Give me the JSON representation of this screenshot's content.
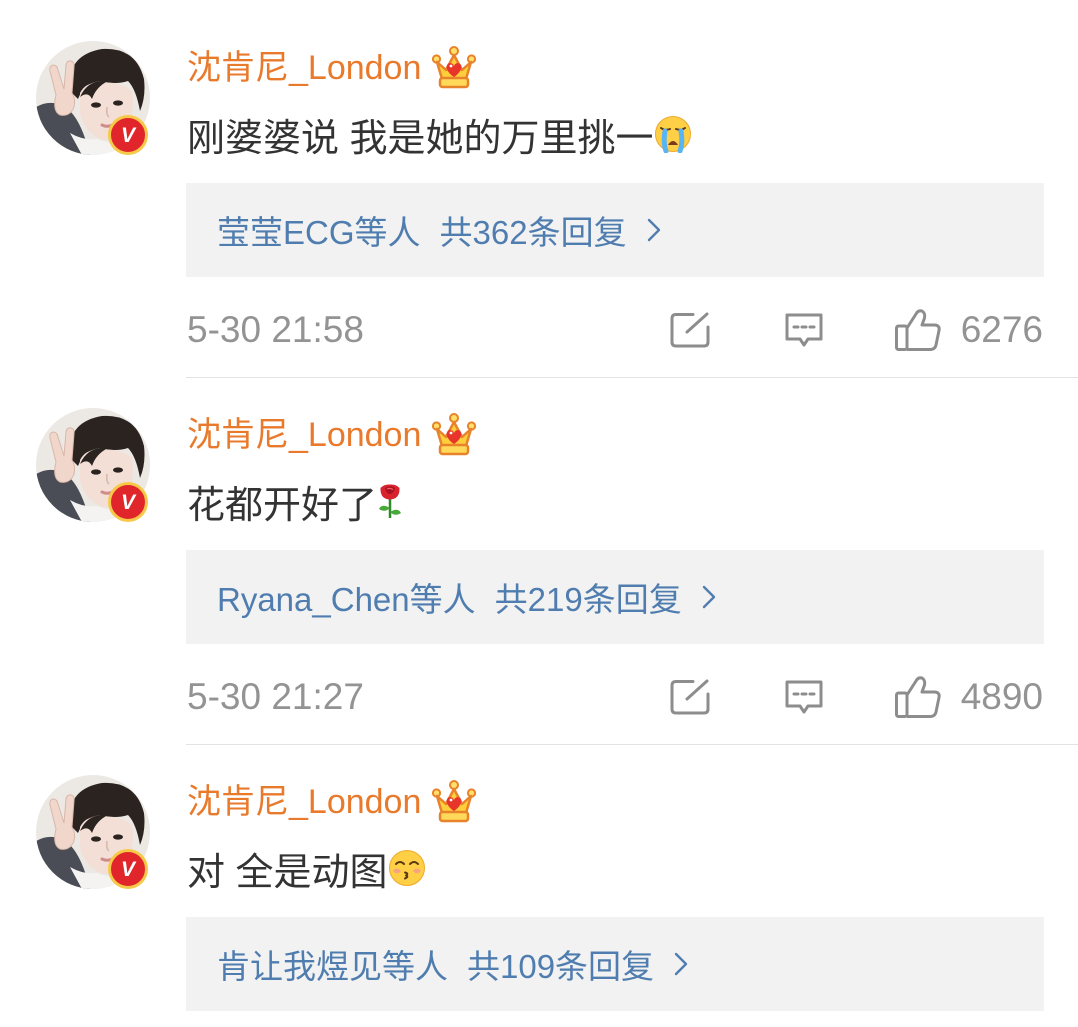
{
  "colors": {
    "username": "#e97a2c",
    "text": "#333333",
    "link": "#507daf",
    "meta": "#939393",
    "icon": "#8d8d8d",
    "reply-bg": "#f2f2f2",
    "divider": "#e3e3e3",
    "verified-bg": "#e1262b",
    "verified-ring": "#f7c948"
  },
  "verified_label": "V",
  "icons": {
    "avatar": "avatar",
    "member_badge": "vip-crown-icon",
    "reply_more": "chevron-right-icon",
    "share": "share-icon",
    "comment": "comment-icon",
    "like": "thumbs-up-icon"
  },
  "comments": [
    {
      "username": "沈肯尼_London",
      "text": "刚婆婆说 我是她的万里挑一",
      "emoji": "crying-face-icon",
      "reply_names": "莹莹ECG等人",
      "reply_count": "共362条回复",
      "time": "5-30 21:58",
      "likes": "6276"
    },
    {
      "username": "沈肯尼_London",
      "text": "花都开好了",
      "emoji": "rose-icon",
      "reply_names": "Ryana_Chen等人",
      "reply_count": "共219条回复",
      "time": "5-30 21:27",
      "likes": "4890"
    },
    {
      "username": "沈肯尼_London",
      "text": "对 全是动图",
      "emoji": "kissing-face-icon",
      "reply_names": "肯让我煜见等人",
      "reply_count": "共109条回复"
    }
  ]
}
